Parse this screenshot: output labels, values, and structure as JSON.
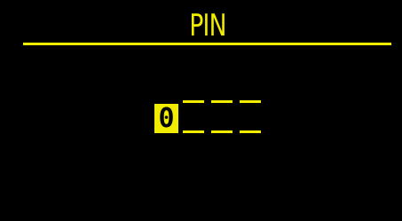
{
  "screen": {
    "title": "PIN",
    "colors": {
      "background": "#000000",
      "accent": "#f2ec00",
      "selected_text": "#000000"
    }
  },
  "pin": {
    "digits": [
      "0",
      "",
      "",
      ""
    ],
    "selected_index": 0
  }
}
